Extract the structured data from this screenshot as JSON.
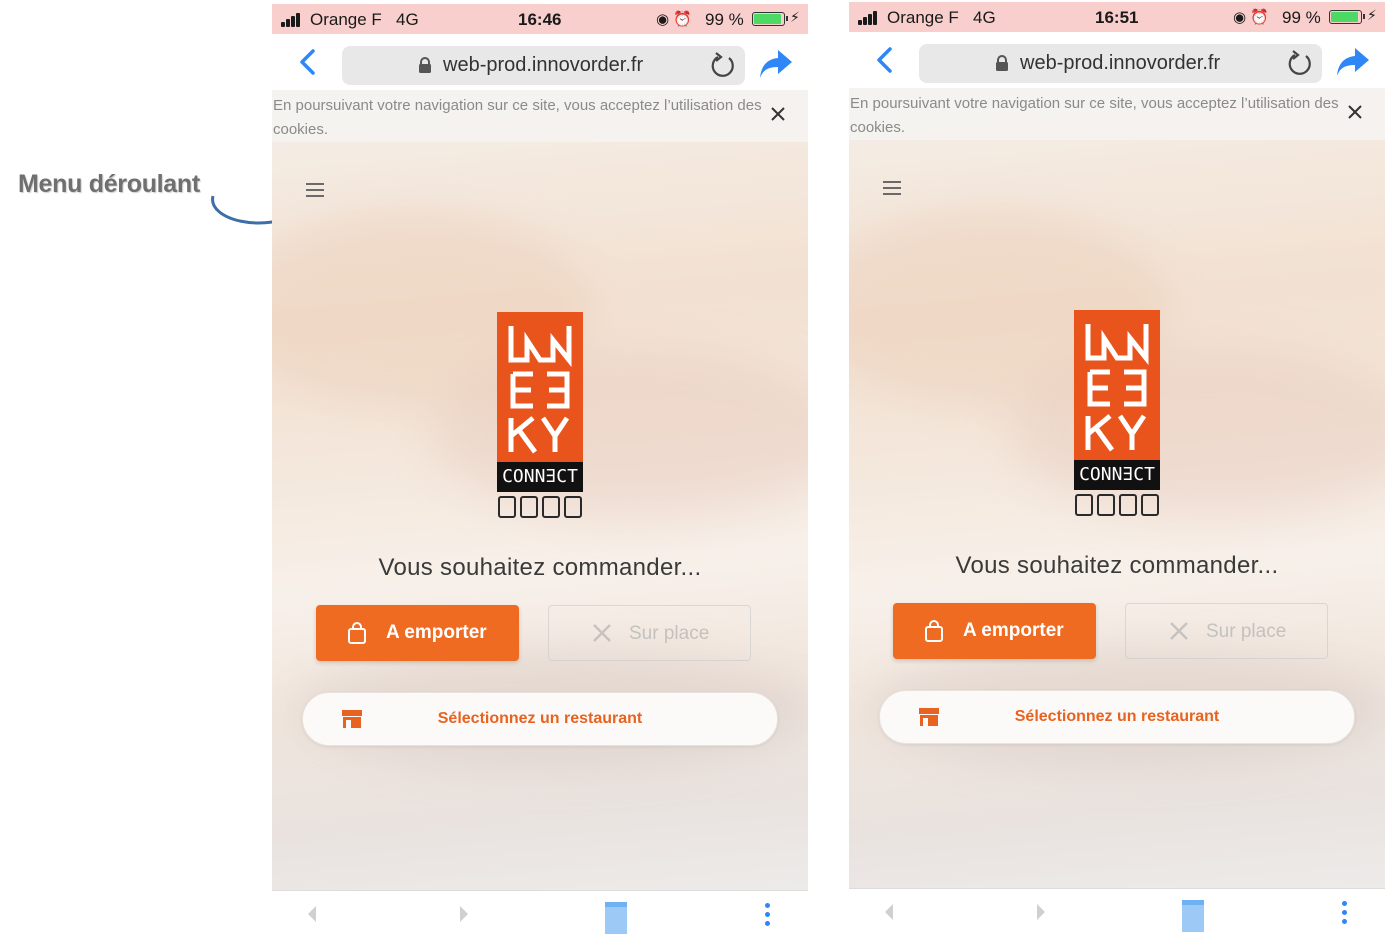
{
  "annotation": {
    "text": "Menu déroulant"
  },
  "colors": {
    "accent": "#ef6b21",
    "ios_blue": "#2f86f6",
    "status_bg": "#f8cfcd"
  },
  "icons": [
    "signal-bars-icon",
    "lock-icon",
    "reload-icon",
    "share-icon",
    "back-chevron-icon",
    "close-icon",
    "hamburger-menu-icon",
    "shopping-bag-icon",
    "cutlery-icon",
    "store-icon",
    "bookmark-icon",
    "more-icon"
  ],
  "screens": [
    {
      "status": {
        "carrier": "Orange F",
        "network": "4G",
        "time": "16:46",
        "battery": "99 %"
      },
      "browser": {
        "url": "web-prod.innovorder.fr"
      },
      "cookie": {
        "text": "En poursuivant votre navigation sur ce site, vous acceptez l’utilisation des cookies."
      },
      "logo": {
        "top": "CONN∃CT"
      },
      "question": "Vous souhaitez commander...",
      "takeaway": "A emporter",
      "onsite": "Sur place",
      "select_restaurant": "Sélectionnez un restaurant"
    },
    {
      "status": {
        "carrier": "Orange F",
        "network": "4G",
        "time": "16:51",
        "battery": "99 %"
      },
      "browser": {
        "url": "web-prod.innovorder.fr"
      },
      "cookie": {
        "text": "En poursuivant votre navigation sur ce site, vous acceptez l’utilisation des cookies."
      },
      "logo": {
        "top": "CONN∃CT"
      },
      "question": "Vous souhaitez commander...",
      "takeaway": "A emporter",
      "onsite": "Sur place",
      "select_restaurant": "Sélectionnez un restaurant"
    }
  ]
}
